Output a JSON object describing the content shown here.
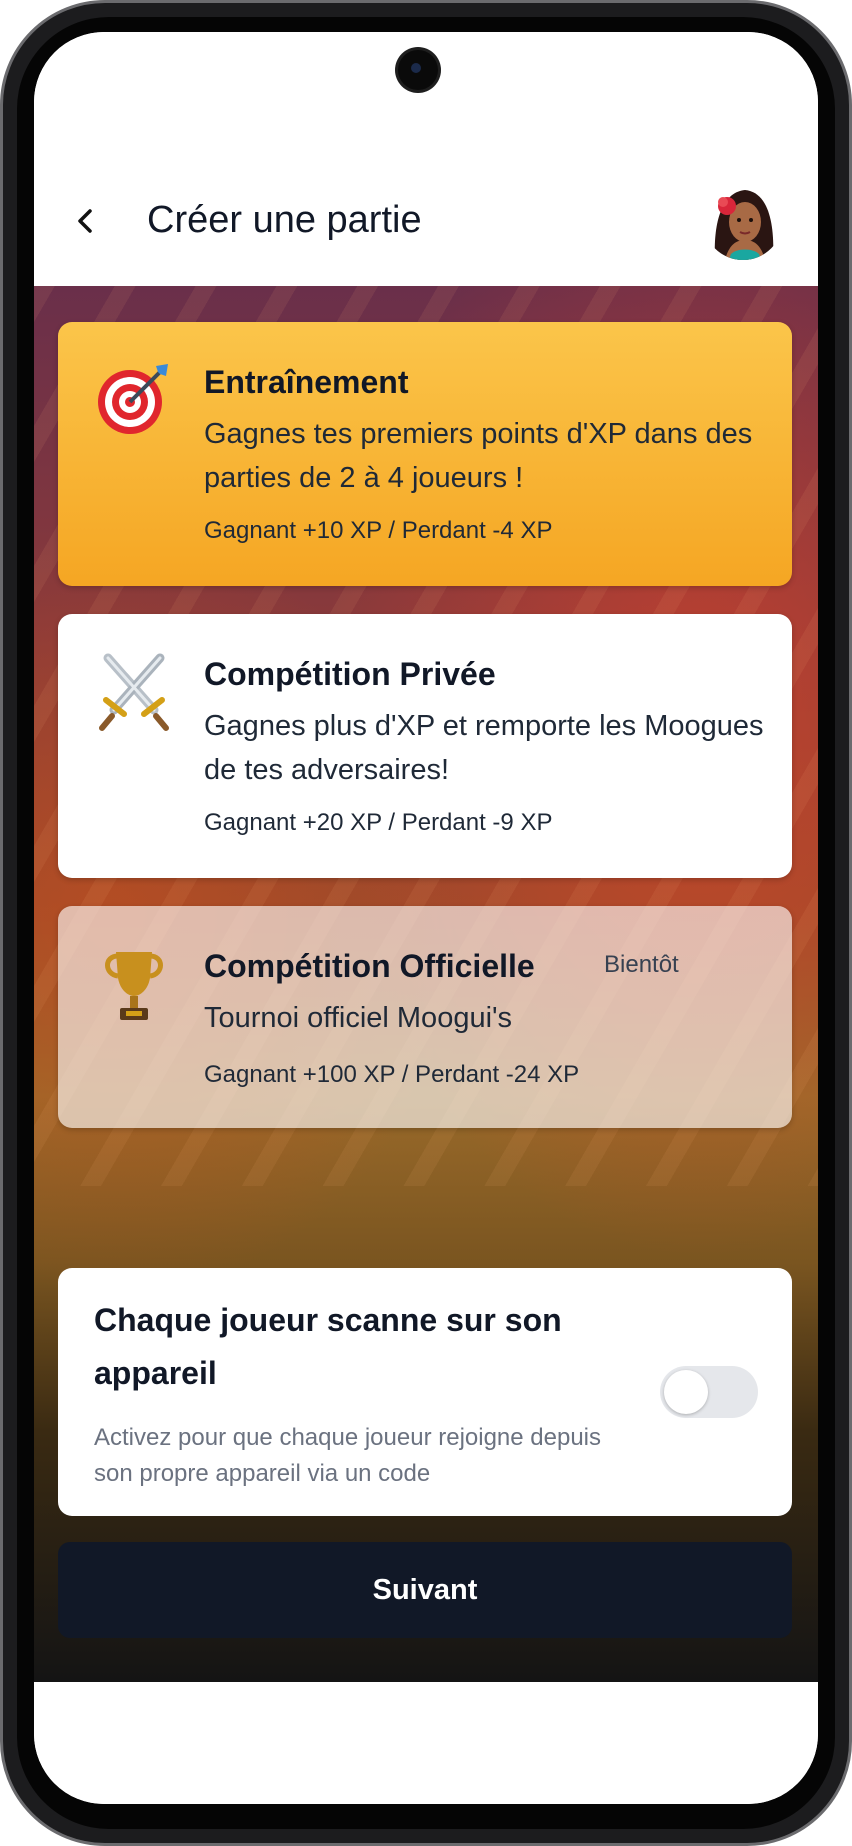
{
  "header": {
    "back_icon": "chevron-left-icon",
    "title": "Créer une partie",
    "avatar_icon": "user-avatar"
  },
  "modes": [
    {
      "icon": "target-dart-icon",
      "title": "Entraînement",
      "description": "Gagnes tes premiers points d'XP dans des parties de 2 à 4 joueurs !",
      "xp": "Gagnant +10 XP / Perdant -4 XP",
      "selected": true
    },
    {
      "icon": "crossed-swords-icon",
      "title": "Compétition Privée",
      "description": "Gagnes plus d'XP et remporte les Moogues de tes adversaires!",
      "xp": "Gagnant +20 XP / Perdant -9 XP",
      "selected": false
    },
    {
      "icon": "trophy-icon",
      "title": "Compétition Officielle",
      "badge": "Bientôt",
      "description": "Tournoi officiel Moogui's",
      "xp": "Gagnant +100 XP / Perdant -24 XP",
      "disabled": true
    }
  ],
  "scan_option": {
    "title": "Chaque joueur scanne sur son appareil",
    "description": "Activez pour que chaque joueur rejoigne depuis son propre appareil via un code",
    "enabled": false
  },
  "next_button": {
    "label": "Suivant"
  },
  "colors": {
    "accent": "#f5a623",
    "button": "#111827",
    "text": "#111827"
  }
}
